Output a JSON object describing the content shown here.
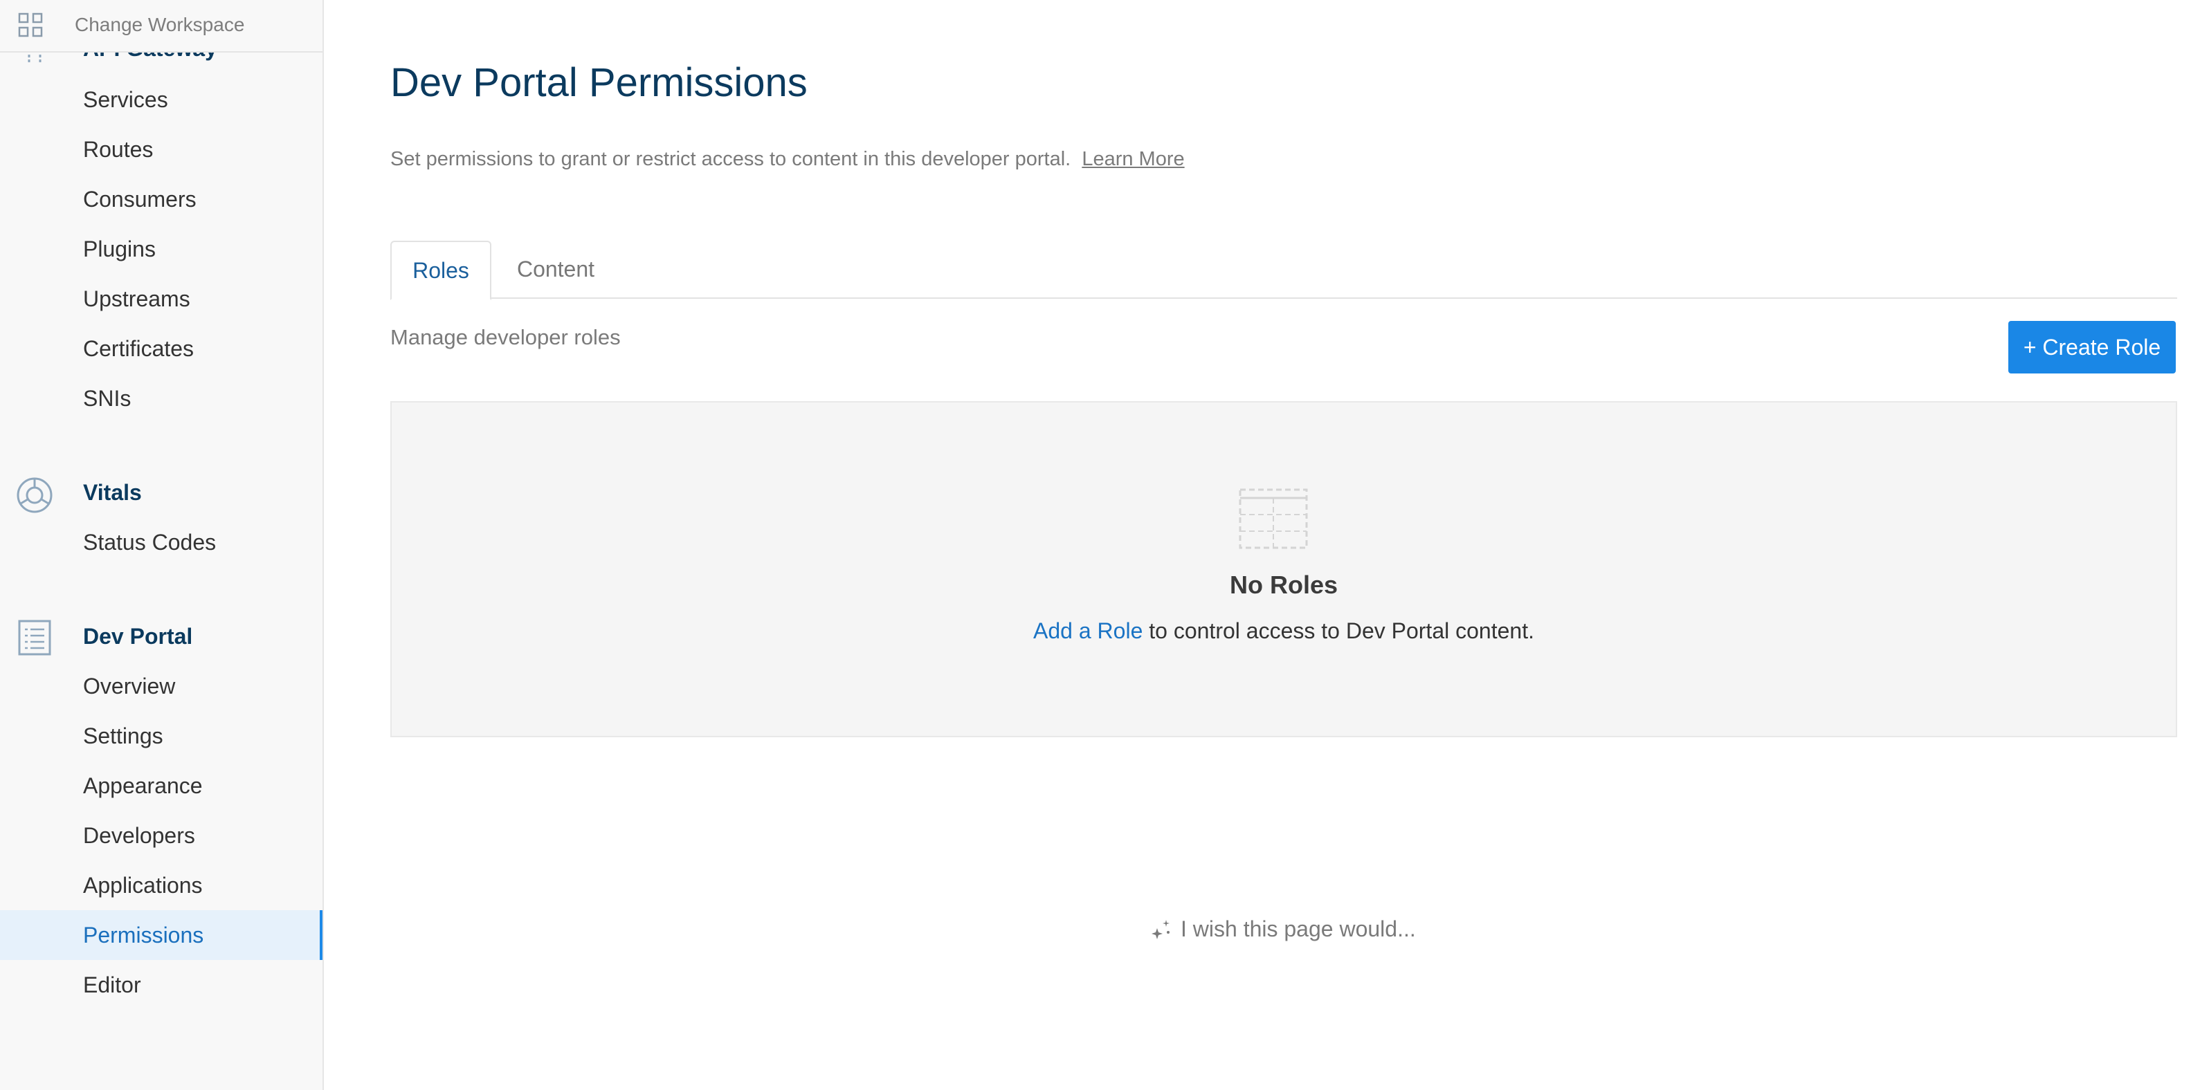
{
  "workspace": {
    "label": "Change Workspace",
    "icon": "grid-icon"
  },
  "sidebar": {
    "api_gateway": {
      "title": "API Gateway",
      "icon": "api-gateway-icon",
      "items": [
        "Services",
        "Routes",
        "Consumers",
        "Plugins",
        "Upstreams",
        "Certificates",
        "SNIs"
      ]
    },
    "vitals": {
      "title": "Vitals",
      "icon": "vitals-icon",
      "items": [
        "Status Codes"
      ]
    },
    "dev_portal": {
      "title": "Dev Portal",
      "icon": "document-icon",
      "items": [
        "Overview",
        "Settings",
        "Appearance",
        "Developers",
        "Applications",
        "Permissions",
        "Editor"
      ],
      "active_item": "Permissions"
    }
  },
  "main": {
    "title": "Dev Portal Permissions",
    "subtitle": "Set permissions to grant or restrict access to content in this developer portal.",
    "learn_more": "Learn More",
    "tabs": [
      {
        "label": "Roles",
        "active": true
      },
      {
        "label": "Content",
        "active": false
      }
    ],
    "manage_text": "Manage developer roles",
    "create_button": "+ Create Role",
    "empty_state": {
      "icon": "empty-table-icon",
      "title": "No Roles",
      "link": "Add a Role",
      "description": " to control access to Dev Portal content."
    },
    "feedback": {
      "icon": "sparkle-icon",
      "text": "I wish this page would..."
    }
  },
  "colors": {
    "brand_navy": "#0b3a5e",
    "primary_button": "#1a87e6",
    "link": "#1a73c4",
    "active_bg": "#e6f1fb"
  }
}
